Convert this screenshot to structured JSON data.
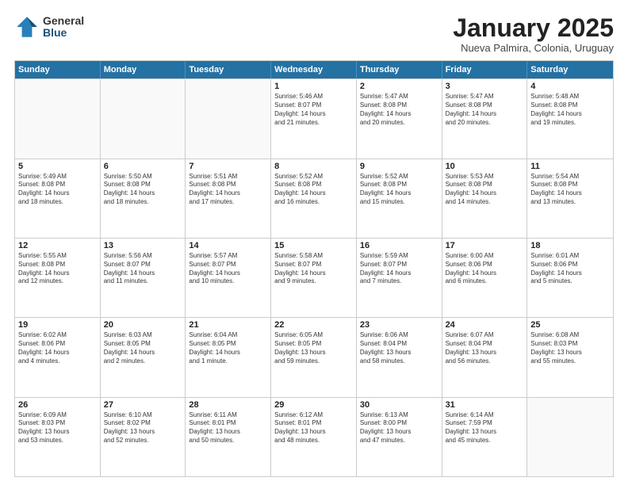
{
  "logo": {
    "general": "General",
    "blue": "Blue"
  },
  "title": "January 2025",
  "subtitle": "Nueva Palmira, Colonia, Uruguay",
  "header_days": [
    "Sunday",
    "Monday",
    "Tuesday",
    "Wednesday",
    "Thursday",
    "Friday",
    "Saturday"
  ],
  "weeks": [
    [
      {
        "day": "",
        "text": ""
      },
      {
        "day": "",
        "text": ""
      },
      {
        "day": "",
        "text": ""
      },
      {
        "day": "1",
        "text": "Sunrise: 5:46 AM\nSunset: 8:07 PM\nDaylight: 14 hours\nand 21 minutes."
      },
      {
        "day": "2",
        "text": "Sunrise: 5:47 AM\nSunset: 8:08 PM\nDaylight: 14 hours\nand 20 minutes."
      },
      {
        "day": "3",
        "text": "Sunrise: 5:47 AM\nSunset: 8:08 PM\nDaylight: 14 hours\nand 20 minutes."
      },
      {
        "day": "4",
        "text": "Sunrise: 5:48 AM\nSunset: 8:08 PM\nDaylight: 14 hours\nand 19 minutes."
      }
    ],
    [
      {
        "day": "5",
        "text": "Sunrise: 5:49 AM\nSunset: 8:08 PM\nDaylight: 14 hours\nand 18 minutes."
      },
      {
        "day": "6",
        "text": "Sunrise: 5:50 AM\nSunset: 8:08 PM\nDaylight: 14 hours\nand 18 minutes."
      },
      {
        "day": "7",
        "text": "Sunrise: 5:51 AM\nSunset: 8:08 PM\nDaylight: 14 hours\nand 17 minutes."
      },
      {
        "day": "8",
        "text": "Sunrise: 5:52 AM\nSunset: 8:08 PM\nDaylight: 14 hours\nand 16 minutes."
      },
      {
        "day": "9",
        "text": "Sunrise: 5:52 AM\nSunset: 8:08 PM\nDaylight: 14 hours\nand 15 minutes."
      },
      {
        "day": "10",
        "text": "Sunrise: 5:53 AM\nSunset: 8:08 PM\nDaylight: 14 hours\nand 14 minutes."
      },
      {
        "day": "11",
        "text": "Sunrise: 5:54 AM\nSunset: 8:08 PM\nDaylight: 14 hours\nand 13 minutes."
      }
    ],
    [
      {
        "day": "12",
        "text": "Sunrise: 5:55 AM\nSunset: 8:08 PM\nDaylight: 14 hours\nand 12 minutes."
      },
      {
        "day": "13",
        "text": "Sunrise: 5:56 AM\nSunset: 8:07 PM\nDaylight: 14 hours\nand 11 minutes."
      },
      {
        "day": "14",
        "text": "Sunrise: 5:57 AM\nSunset: 8:07 PM\nDaylight: 14 hours\nand 10 minutes."
      },
      {
        "day": "15",
        "text": "Sunrise: 5:58 AM\nSunset: 8:07 PM\nDaylight: 14 hours\nand 9 minutes."
      },
      {
        "day": "16",
        "text": "Sunrise: 5:59 AM\nSunset: 8:07 PM\nDaylight: 14 hours\nand 7 minutes."
      },
      {
        "day": "17",
        "text": "Sunrise: 6:00 AM\nSunset: 8:06 PM\nDaylight: 14 hours\nand 6 minutes."
      },
      {
        "day": "18",
        "text": "Sunrise: 6:01 AM\nSunset: 8:06 PM\nDaylight: 14 hours\nand 5 minutes."
      }
    ],
    [
      {
        "day": "19",
        "text": "Sunrise: 6:02 AM\nSunset: 8:06 PM\nDaylight: 14 hours\nand 4 minutes."
      },
      {
        "day": "20",
        "text": "Sunrise: 6:03 AM\nSunset: 8:05 PM\nDaylight: 14 hours\nand 2 minutes."
      },
      {
        "day": "21",
        "text": "Sunrise: 6:04 AM\nSunset: 8:05 PM\nDaylight: 14 hours\nand 1 minute."
      },
      {
        "day": "22",
        "text": "Sunrise: 6:05 AM\nSunset: 8:05 PM\nDaylight: 13 hours\nand 59 minutes."
      },
      {
        "day": "23",
        "text": "Sunrise: 6:06 AM\nSunset: 8:04 PM\nDaylight: 13 hours\nand 58 minutes."
      },
      {
        "day": "24",
        "text": "Sunrise: 6:07 AM\nSunset: 8:04 PM\nDaylight: 13 hours\nand 56 minutes."
      },
      {
        "day": "25",
        "text": "Sunrise: 6:08 AM\nSunset: 8:03 PM\nDaylight: 13 hours\nand 55 minutes."
      }
    ],
    [
      {
        "day": "26",
        "text": "Sunrise: 6:09 AM\nSunset: 8:03 PM\nDaylight: 13 hours\nand 53 minutes."
      },
      {
        "day": "27",
        "text": "Sunrise: 6:10 AM\nSunset: 8:02 PM\nDaylight: 13 hours\nand 52 minutes."
      },
      {
        "day": "28",
        "text": "Sunrise: 6:11 AM\nSunset: 8:01 PM\nDaylight: 13 hours\nand 50 minutes."
      },
      {
        "day": "29",
        "text": "Sunrise: 6:12 AM\nSunset: 8:01 PM\nDaylight: 13 hours\nand 48 minutes."
      },
      {
        "day": "30",
        "text": "Sunrise: 6:13 AM\nSunset: 8:00 PM\nDaylight: 13 hours\nand 47 minutes."
      },
      {
        "day": "31",
        "text": "Sunrise: 6:14 AM\nSunset: 7:59 PM\nDaylight: 13 hours\nand 45 minutes."
      },
      {
        "day": "",
        "text": ""
      }
    ]
  ]
}
